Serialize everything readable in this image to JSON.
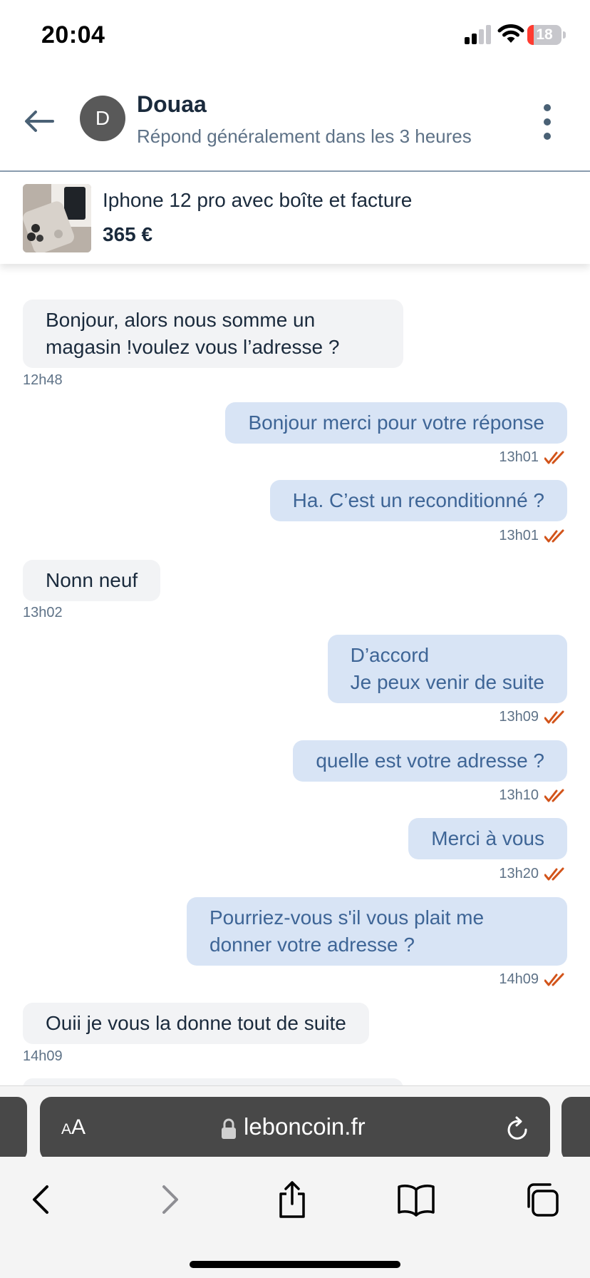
{
  "status_bar": {
    "time": "20:04",
    "battery": "18",
    "battery_level": 0.18
  },
  "header": {
    "back_icon": "arrow-left-icon",
    "avatar_letter": "D",
    "contact_name": "Douaa",
    "contact_status": "Répond généralement dans les 3 heures",
    "more_icon": "more-vertical-icon"
  },
  "listing": {
    "title": "Iphone 12 pro avec boîte et facture",
    "price": "365 €"
  },
  "messages": [
    {
      "direction": "in",
      "lines": [
        "Bonjour, alors nous somme un",
        "magasin !voulez vous l’adresse ?"
      ],
      "time": "12h48"
    },
    {
      "direction": "out",
      "lines": [
        "Bonjour merci pour votre réponse"
      ],
      "time": "13h01",
      "read": true
    },
    {
      "direction": "out",
      "lines": [
        "Ha. C’est un reconditionné ?"
      ],
      "time": "13h01",
      "read": true
    },
    {
      "direction": "in",
      "lines": [
        "Nonn neuf"
      ],
      "time": "13h02"
    },
    {
      "direction": "out",
      "lines": [
        "D’accord",
        "Je peux venir de suite"
      ],
      "time": "13h09",
      "read": true
    },
    {
      "direction": "out",
      "lines": [
        "quelle est votre adresse ?"
      ],
      "time": "13h10",
      "read": true
    },
    {
      "direction": "out",
      "lines": [
        "Merci à vous"
      ],
      "time": "13h20",
      "read": true
    },
    {
      "direction": "out",
      "lines": [
        "Pourriez-vous s'il vous plait me",
        "donner votre adresse ?"
      ],
      "time": "14h09",
      "read": true
    },
    {
      "direction": "in",
      "lines": [
        "Ouii je vous la donne tout de suite"
      ],
      "time": "14h09"
    }
  ],
  "browser": {
    "text_size_label_small": "A",
    "text_size_label_large": "A",
    "url": "leboncoin.fr"
  },
  "colors": {
    "read_ticks": "#d2541a",
    "outgoing_bubble": "#d8e4f5",
    "incoming_bubble": "#f2f3f5",
    "outgoing_text": "#3e6596"
  }
}
